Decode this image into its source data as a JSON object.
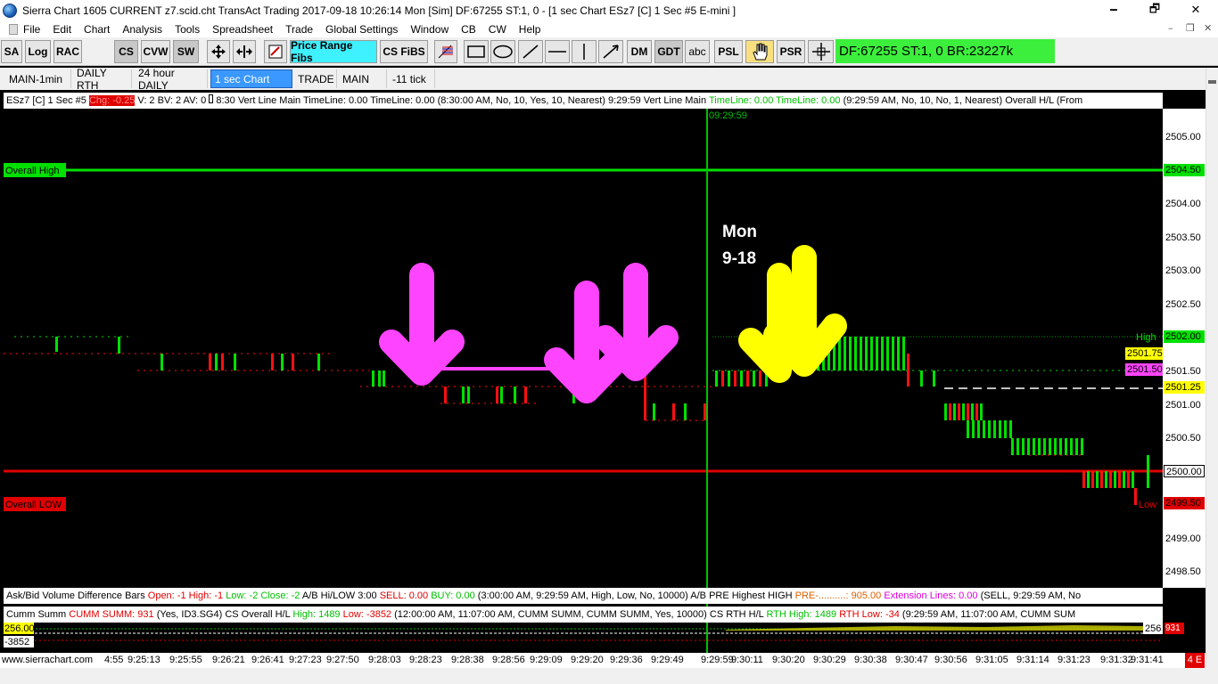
{
  "window": {
    "title": "Sierra Chart 1605 CURRENT z7.scid.cht  TransAct Trading 2017-09-18  10:26:14 Mon [Sim]  DF:67255  ST:1, 0 - [1 sec  Chart        ESz7 [C]  1 Sec   #5  E-mini ]",
    "minimize": "🗕",
    "maximize": "🗗",
    "close": "✕"
  },
  "menu": {
    "items": [
      "File",
      "Edit",
      "Chart",
      "Analysis",
      "Tools",
      "Spreadsheet",
      "Trade",
      "Global Settings",
      "Window",
      "CB",
      "CW",
      "Help"
    ],
    "mdi_min": "–",
    "mdi_restore": "❐",
    "mdi_close": "✕"
  },
  "toolbar": {
    "sa": "SA",
    "log": "Log",
    "rac": "RAC",
    "cs": "CS",
    "cvw": "CVW",
    "sw": "SW",
    "price_range_fibs": "Price Range Fibs",
    "cs_fibs": "CS FiBS",
    "dm": "DM",
    "gdt": "GDT",
    "abc": "abc",
    "psl": "PSL",
    "psr": "PSR",
    "status": "DF:67255   ST:1, 0   BR:23227k"
  },
  "tabs": [
    "MAIN-1min",
    "DAILY RTH",
    "24 hour DAILY",
    "1 sec  Chart",
    "TRADE",
    "MAIN",
    "-11 tick"
  ],
  "chart_info": {
    "symbol": "ESz7 [C]  1 Sec   #5",
    "chg": "Chg: -0.25",
    "vol": "V: 2 BV: 2 AV: 0",
    "study1": "8:30 Vert Line Main  TimeLine: 0.00  TimeLine: 0.00   (8:30:00 AM, No, 10, Yes, 10, Nearest)",
    "study2": "9:29:59 Vert Line Main",
    "study2_vals": "TimeLine: 0.00   TimeLine: 0.00",
    "study2_params": "(9:29:59 AM, No, 10, No, 1, Nearest)   Overall H/L (From"
  },
  "chart": {
    "overall_high_label": "Overall High",
    "overall_low_label": "Overall LOW",
    "high_label": "High",
    "low_label": "Low",
    "vline_time": "09:29:59",
    "annotation_line1": "Mon",
    "annotation_line2": "9-18",
    "colors": {
      "up": "#00e000",
      "down": "#ff1010",
      "overall_high": "#00e000",
      "overall_low": "#e00000",
      "vline": "#00c000",
      "magenta": "#ff44ff",
      "yellow": "#ffff00"
    }
  },
  "price_scale": {
    "ticks": [
      "2505.00",
      "2504.00",
      "2503.50",
      "2503.00",
      "2502.50",
      "2501.50",
      "2501.00",
      "2500.50",
      "2499.00",
      "2498.50"
    ],
    "overall_high": "2504.50",
    "high": "2502.00",
    "p1": "2501.75",
    "p2": "2501.50",
    "last": "2501.25",
    "p3": "2500.00",
    "overall_low": "2499.50"
  },
  "subgraph1": {
    "title": "Ask/Bid Volume Difference Bars",
    "open": "Open: -1",
    "high": "High: -1",
    "low": "Low: -2",
    "close": "Close: -2",
    "ab": "A/B Hi/LOW 3:00",
    "sell": "SELL: 0.00",
    "buy": "BUY: 0.00",
    "params": "(3:00:00 AM, 9:29:59 AM, High, Low, No, 10000)  A/B PRE Highest HIGH",
    "pre": "PRE-..........: 905.00",
    "ext": "Extension Lines: 0.00",
    "tail": "(SELL, 9:29:59 AM, No"
  },
  "subgraph2": {
    "title": "Cumm Summ",
    "summ": "CUMM SUMM: 931",
    "params": "(Yes, ID3.SG4)  CS Overall H/L",
    "high": "High: 1489",
    "low": "Low: -3852",
    "params2": "(12:00:00 AM, 11:07:00 AM, CUMM SUMM, CUMM SUMM, Yes, 10000)  CS RTH H/L",
    "rth_high": "RTH High: 1489",
    "rth_low": "RTH Low: -34",
    "tail": "(9:29:59 AM, 11:07:00 AM, CUMM SUM",
    "val_top": "256.00",
    "val_bottom": "-3852",
    "val_right": "256",
    "val_right2": "931"
  },
  "time_axis": {
    "site": "www.sierrachart.com",
    "labels": [
      "4:55",
      "9:25:13",
      "9:25:55",
      "9:26:21",
      "9:26:41",
      "9:27:23",
      "9:27:50",
      "9:28:03",
      "9:28:23",
      "9:28:38",
      "9:28:56",
      "9:29:09",
      "9:29:20",
      "9:29:36",
      "9:29:49",
      "9:29:59",
      "9:30:11",
      "9:30:20",
      "9:30:29",
      "9:30:38",
      "9:30:47",
      "9:30:56",
      "9:31:05",
      "9:31:14",
      "9:31:23",
      "9:31:32",
      "9:31:41"
    ],
    "badge": "4 E"
  }
}
